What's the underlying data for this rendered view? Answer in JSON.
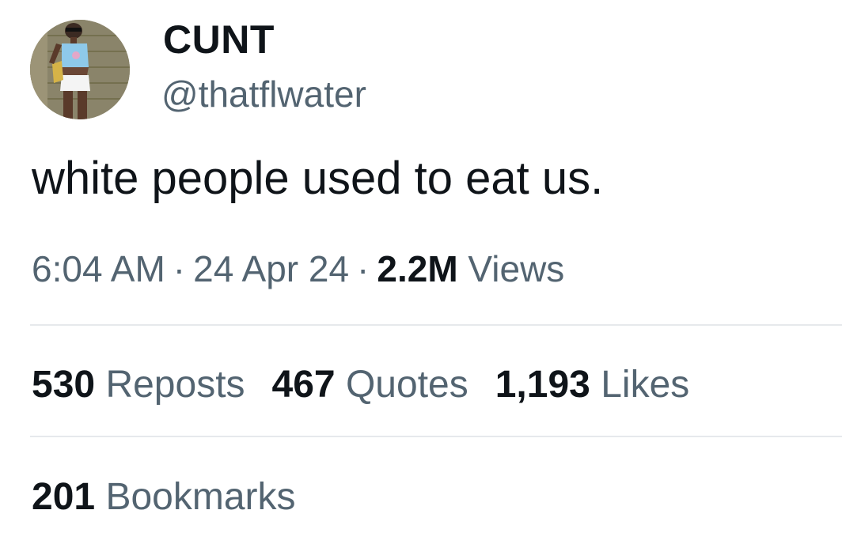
{
  "tweet": {
    "display_name": "CUNT",
    "handle": "@thatflwater",
    "text": "white people used to eat us.",
    "time": "6:04 AM",
    "separator": "·",
    "date": "24 Apr 24",
    "views_count": "2.2M",
    "views_label": "Views"
  },
  "stats": {
    "reposts_count": "530",
    "reposts_label": "Reposts",
    "quotes_count": "467",
    "quotes_label": "Quotes",
    "likes_count": "1,193",
    "likes_label": "Likes",
    "bookmarks_count": "201",
    "bookmarks_label": "Bookmarks"
  },
  "colors": {
    "text_primary": "#0f1419",
    "text_secondary": "#536471",
    "divider": "#e6e9ec",
    "background": "#ffffff"
  }
}
